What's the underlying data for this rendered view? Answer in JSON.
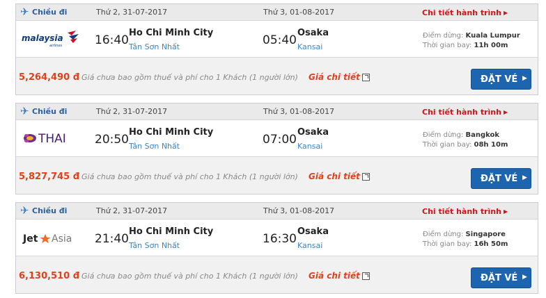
{
  "flights": [
    {
      "direction_label": "Chiều đi",
      "dep_date": "Thứ 2, 31-07-2017",
      "arr_date": "Thứ 3, 01-08-2017",
      "detail_link": "Chi tiết hành trình",
      "airline_logo": "malaysia",
      "logo_text": "malaysia",
      "logo_sub": "airlines",
      "dep_time": "16:40",
      "dep_city": "Ho Chi Minh City",
      "dep_airport": "Tân Sơn Nhất",
      "arr_time": "05:40",
      "arr_city": "Osaka",
      "arr_airport": "Kansai",
      "stop_label": "Điểm dừng:",
      "stop_value": "Kuala Lumpur",
      "duration_label": "Thời gian bay:",
      "duration_value": "11h 00m",
      "price": "5,264,490 đ",
      "price_note": "Giá chưa bao gồm thuế và phí cho 1 Khách (1 người lớn)",
      "price_detail": "Giá chi tiết",
      "book_label": "ĐẶT VÉ"
    },
    {
      "direction_label": "Chiều đi",
      "dep_date": "Thứ 2, 31-07-2017",
      "arr_date": "Thứ 3, 01-08-2017",
      "detail_link": "Chi tiết hành trình",
      "airline_logo": "thai",
      "logo_text": "THAI",
      "dep_time": "20:50",
      "dep_city": "Ho Chi Minh City",
      "dep_airport": "Tân Sơn Nhất",
      "arr_time": "07:00",
      "arr_city": "Osaka",
      "arr_airport": "Kansai",
      "stop_label": "Điểm dừng:",
      "stop_value": "Bangkok",
      "duration_label": "Thời gian bay:",
      "duration_value": "08h 10m",
      "price": "5,827,745 đ",
      "price_note": "Giá chưa bao gồm thuế và phí cho 1 Khách (1 người lớn)",
      "price_detail": "Giá chi tiết",
      "book_label": "ĐẶT VÉ"
    },
    {
      "direction_label": "Chiều đi",
      "dep_date": "Thứ 2, 31-07-2017",
      "arr_date": "Thứ 3, 01-08-2017",
      "detail_link": "Chi tiết hành trình",
      "airline_logo": "jetstar-asia",
      "logo_text_a": "Jet",
      "logo_text_b": "Asia",
      "dep_time": "21:40",
      "dep_city": "Ho Chi Minh City",
      "dep_airport": "Tân Sơn Nhất",
      "arr_time": "16:30",
      "arr_city": "Osaka",
      "arr_airport": "Kansai",
      "stop_label": "Điểm dừng:",
      "stop_value": "Singapore",
      "duration_label": "Thời gian bay:",
      "duration_value": "16h 50m",
      "price": "6,130,510 đ",
      "price_note": "Giá chưa bao gồm thuế và phí cho 1 Khách (1 người lớn)",
      "price_detail": "Giá chi tiết",
      "book_label": "ĐẶT VÉ"
    }
  ],
  "colors": {
    "accent_blue": "#1e65b0",
    "price_red": "#e0401b",
    "link_red": "#d0161b",
    "airport_blue": "#3d86c6"
  }
}
